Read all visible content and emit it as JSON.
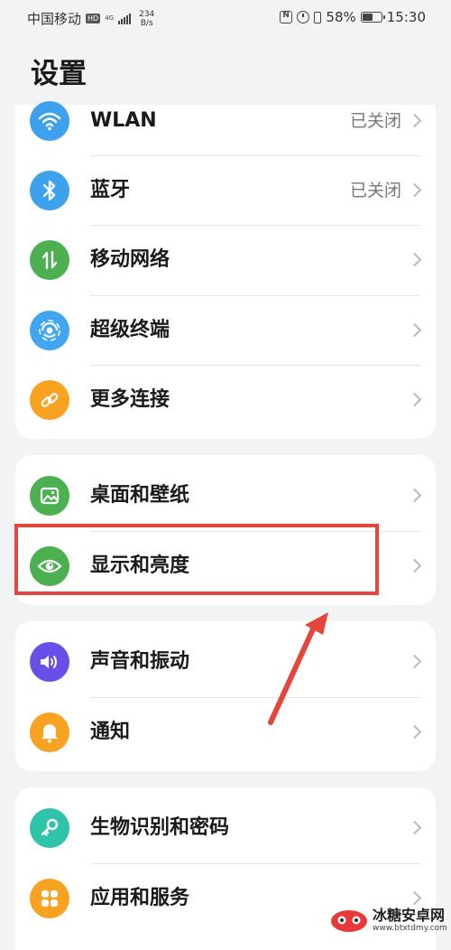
{
  "status_bar": {
    "carrier": "中国移动",
    "hd": "HD",
    "network": "4G",
    "speed_value": "234",
    "speed_unit": "B/s",
    "battery": "58%",
    "battery_level": 0.58,
    "time": "15:30"
  },
  "page": {
    "title": "设置"
  },
  "groups": [
    {
      "items": [
        {
          "label": "WLAN",
          "value": "已关闭",
          "icon": "wifi-icon",
          "color": "#3ea1ee"
        },
        {
          "label": "蓝牙",
          "value": "已关闭",
          "icon": "bluetooth-icon",
          "color": "#3ea1ee"
        },
        {
          "label": "移动网络",
          "value": "",
          "icon": "mobile-data-icon",
          "color": "#4caf50"
        },
        {
          "label": "超级终端",
          "value": "",
          "icon": "super-device-icon",
          "color": "#42a5ef"
        },
        {
          "label": "更多连接",
          "value": "",
          "icon": "link-icon",
          "color": "#f7a221"
        }
      ]
    },
    {
      "items": [
        {
          "label": "桌面和壁纸",
          "value": "",
          "icon": "wallpaper-icon",
          "color": "#4caf50"
        },
        {
          "label": "显示和亮度",
          "value": "",
          "icon": "eye-icon",
          "color": "#4caf50"
        }
      ]
    },
    {
      "items": [
        {
          "label": "声音和振动",
          "value": "",
          "icon": "speaker-icon",
          "color": "#6a4ee8"
        },
        {
          "label": "通知",
          "value": "",
          "icon": "bell-icon",
          "color": "#f7a221"
        }
      ]
    },
    {
      "items": [
        {
          "label": "生物识别和密码",
          "value": "",
          "icon": "key-icon",
          "color": "#2fc3a9"
        },
        {
          "label": "应用和服务",
          "value": "",
          "icon": "apps-icon",
          "color": "#f7a221"
        }
      ]
    }
  ],
  "annotation": {
    "highlight_color": "#e4463c"
  },
  "watermark": {
    "title": "冰糖安卓网",
    "url": "www.btxtdmy.com"
  }
}
